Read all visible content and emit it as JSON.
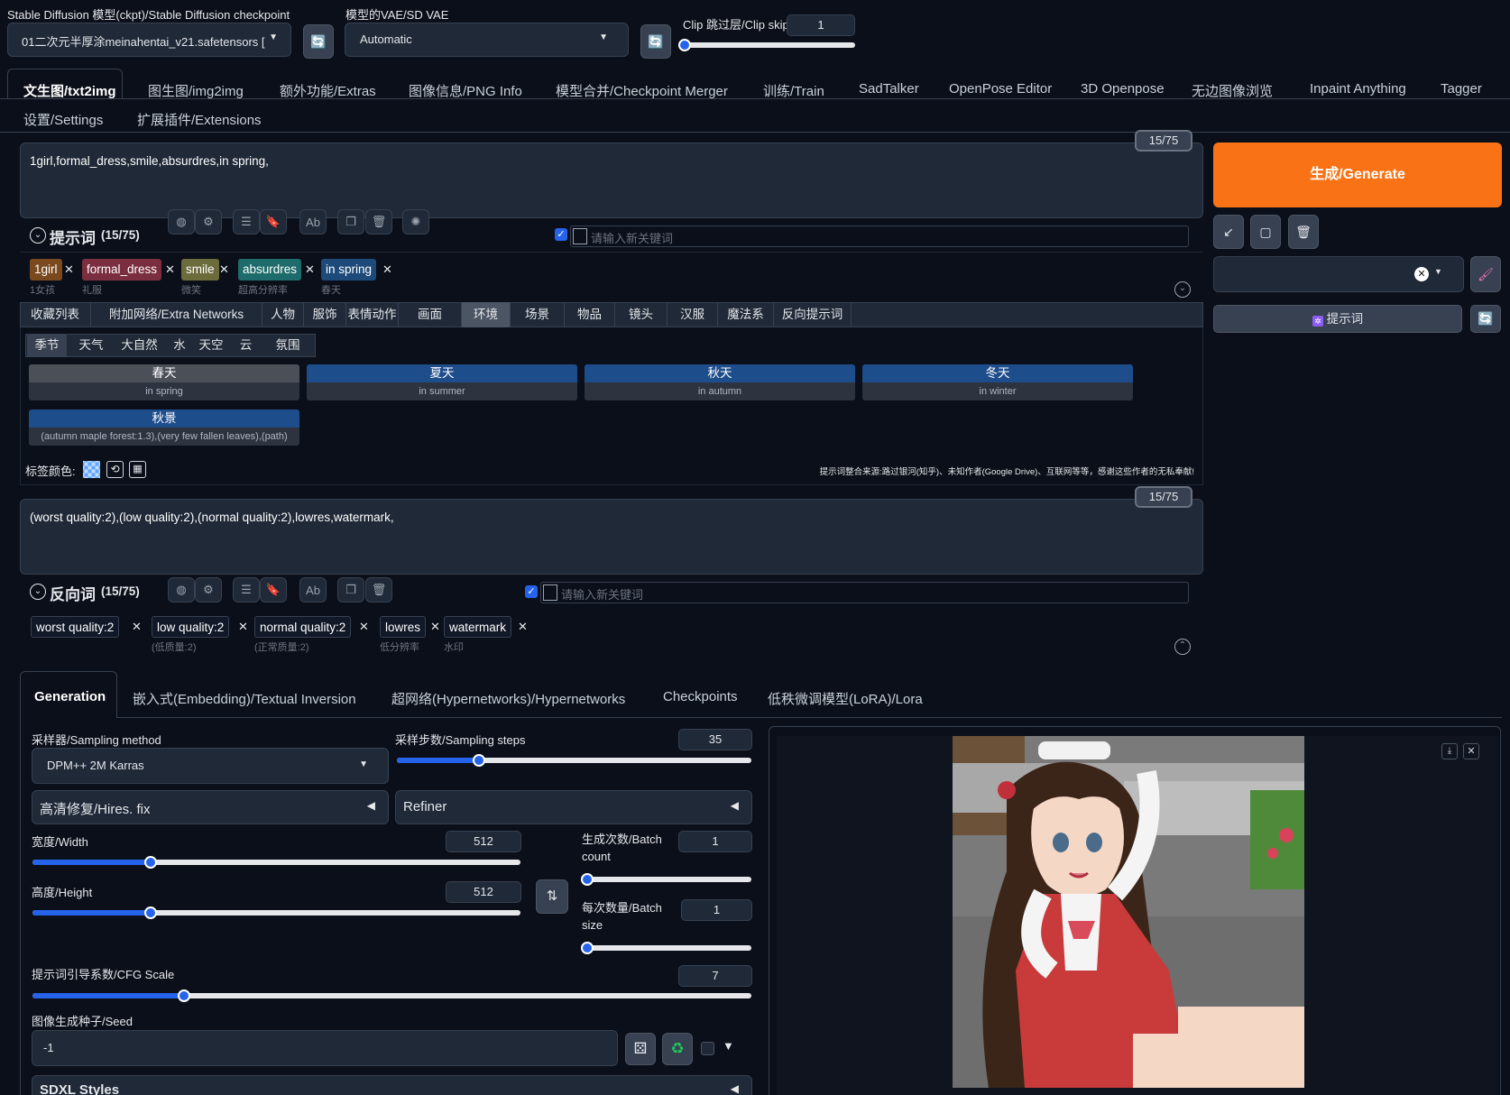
{
  "top": {
    "checkpoint_label": "Stable Diffusion 模型(ckpt)/Stable Diffusion checkpoint",
    "checkpoint_value": "01二次元半厚涂meinahentai_v21.safetensors [",
    "vae_label": "模型的VAE/SD VAE",
    "vae_value": "Automatic",
    "clip_label": "Clip 跳过层/Clip skip",
    "clip_value": "1",
    "clip_level": 0
  },
  "tabs": [
    "文生图/txt2img",
    "图生图/img2img",
    "额外功能/Extras",
    "图像信息/PNG Info",
    "模型合并/Checkpoint Merger",
    "训练/Train",
    "SadTalker",
    "OpenPose Editor",
    "3D Openpose",
    "无边图像浏览",
    "Inpaint Anything",
    "Tagger"
  ],
  "tabs_row2": [
    "设置/Settings",
    "扩展插件/Extensions"
  ],
  "prompt": {
    "text": "1girl,formal_dress,smile,absurdres,in spring,",
    "counter": "15/75",
    "section_title": "提示词",
    "section_count": "(15/75)",
    "keyword_placeholder": "请输入新关键词",
    "tags": [
      {
        "text": "1girl",
        "sub": "1女孩",
        "color": "#7a4a1e"
      },
      {
        "text": "formal_dress",
        "sub": "礼服",
        "color": "#7a2e3f"
      },
      {
        "text": "smile",
        "sub": "微笑",
        "color": "#6b6b3c"
      },
      {
        "text": "absurdres",
        "sub": "超高分辨率",
        "color": "#1e6b6b"
      },
      {
        "text": "in spring",
        "sub": "春天",
        "color": "#1e4a7a"
      }
    ]
  },
  "categories": [
    "收藏列表",
    "附加网络/Extra Networks",
    "人物",
    "服饰",
    "表情动作",
    "画面",
    "环境",
    "场景",
    "物品",
    "镜头",
    "汉服",
    "魔法系",
    "反向提示词"
  ],
  "subcategories": [
    "季节",
    "天气",
    "大自然",
    "水",
    "天空",
    "云",
    "氛围"
  ],
  "cards": [
    {
      "title": "春天",
      "sub": "in spring",
      "color": "#4a4f58"
    },
    {
      "title": "夏天",
      "sub": "in summer",
      "color": "#1e4d8c"
    },
    {
      "title": "秋天",
      "sub": "in autumn",
      "color": "#1e4d8c"
    },
    {
      "title": "冬天",
      "sub": "in winter",
      "color": "#1e4d8c"
    },
    {
      "title": "秋景",
      "sub": "(autumn maple forest:1.3),(very few fallen leaves),(path)",
      "color": "#1e4d8c"
    }
  ],
  "tag_color_label": "标签颜色:",
  "credits": "提示词整合来源:路过银河(知乎)、未知作者(Google Drive)、互联网等等，感谢这些作者的无私奉献!",
  "negative": {
    "text": "(worst quality:2),(low quality:2),(normal quality:2),lowres,watermark,",
    "counter": "15/75",
    "section_title": "反向词",
    "section_count": "(15/75)",
    "keyword_placeholder": "请输入新关键词",
    "tags": [
      {
        "text": "worst quality:2",
        "sub": ""
      },
      {
        "text": "low quality:2",
        "sub": "(低质量:2)"
      },
      {
        "text": "normal quality:2",
        "sub": "(正常质量:2)"
      },
      {
        "text": "lowres",
        "sub": "低分辨率"
      },
      {
        "text": "watermark",
        "sub": "水印"
      }
    ]
  },
  "right": {
    "generate": "生成/Generate",
    "prompt_btn": "提示词"
  },
  "bottom_tabs": [
    "Generation",
    "嵌入式(Embedding)/Textual Inversion",
    "超网络(Hypernetworks)/Hypernetworks",
    "Checkpoints",
    "低秩微调模型(LoRA)/Lora"
  ],
  "gen": {
    "sampler_label": "采样器/Sampling method",
    "sampler_value": "DPM++ 2M Karras",
    "steps_label": "采样步数/Sampling steps",
    "steps_value": "35",
    "steps_level": 0.23,
    "hires": "高清修复/Hires. fix",
    "refiner": "Refiner",
    "width_label": "宽度/Width",
    "width_value": "512",
    "width_level": 0.24,
    "height_label": "高度/Height",
    "height_value": "512",
    "height_level": 0.24,
    "batch_count_label": "生成次数/Batch count",
    "batch_count_value": "1",
    "batch_count_level": 0,
    "batch_size_label": "每次数量/Batch size",
    "batch_size_value": "1",
    "batch_size_level": 0,
    "cfg_label": "提示词引导系数/CFG Scale",
    "cfg_value": "7",
    "cfg_level": 0.21,
    "seed_label": "图像生成种子/Seed",
    "seed_value": "-1",
    "sdxl": "SDXL Styles"
  },
  "colors": {
    "accent": "#2563eb",
    "generate": "#f97316",
    "bg": "#0b0f19"
  }
}
